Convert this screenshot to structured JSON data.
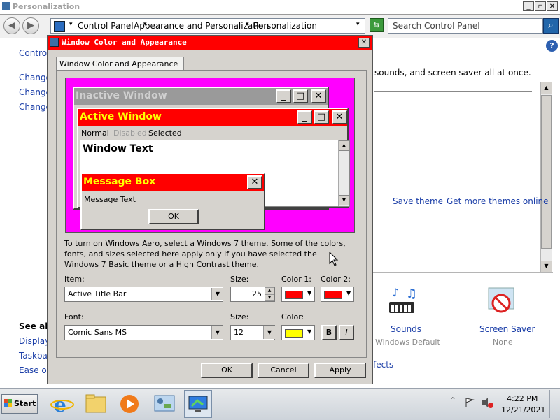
{
  "parent_window": {
    "title": "Personalization",
    "breadcrumb": [
      "Control Panel",
      "Appearance and Personalization",
      "Personalization"
    ],
    "search_placeholder": "Search Control Panel",
    "header_text": "sounds, and screen saver all at once.",
    "left_links": [
      "Control",
      "Change",
      "Change",
      "Change"
    ],
    "see_also": {
      "heading": "See als",
      "links": [
        "Display",
        "Taskbar",
        "Ease of"
      ]
    },
    "theme_links": {
      "save": "Save theme",
      "more": "Get more themes online"
    },
    "items": [
      {
        "label": "Sounds",
        "sub": "Windows Default"
      },
      {
        "label": "Screen Saver",
        "sub": "None"
      }
    ],
    "effects_text": "fects"
  },
  "dialog": {
    "title": "Window Color and Appearance",
    "tab": "Window Color and Appearance",
    "preview": {
      "inactive_title": "Inactive Window",
      "active_title": "Active Window",
      "menu": {
        "normal": "Normal",
        "disabled": "Disabled",
        "selected": "Selected"
      },
      "window_text": "Window Text",
      "msgbox_title": "Message Box",
      "msgbox_text": "Message Text",
      "msgbox_ok": "OK"
    },
    "info": "To turn on Windows Aero, select a Windows 7 theme.  Some of the colors, fonts, and sizes selected here apply only if you have selected the Windows 7 Basic theme or a High Contrast theme.",
    "item_label": "Item:",
    "item_value": "Active Title Bar",
    "size_label": "Size:",
    "item_size": "25",
    "color1_label": "Color 1:",
    "color2_label": "Color 2:",
    "font_label": "Font:",
    "font_value": "Comic Sans MS",
    "font_size_label": "Size:",
    "font_size": "12",
    "color_label": "Color:",
    "bold": "B",
    "italic": "I",
    "buttons": {
      "ok": "OK",
      "cancel": "Cancel",
      "apply": "Apply"
    }
  },
  "taskbar": {
    "start": "Start",
    "time": "4:22 PM",
    "date": "12/21/2021"
  },
  "colors": {
    "active_title": "#ff0000",
    "active_title_text": "#ffff00",
    "inactive_title": "#9a9a9a",
    "preview_bg": "#ff00ff",
    "color1": "#ff0000",
    "color2": "#ff0000",
    "font_color": "#ffff00"
  }
}
